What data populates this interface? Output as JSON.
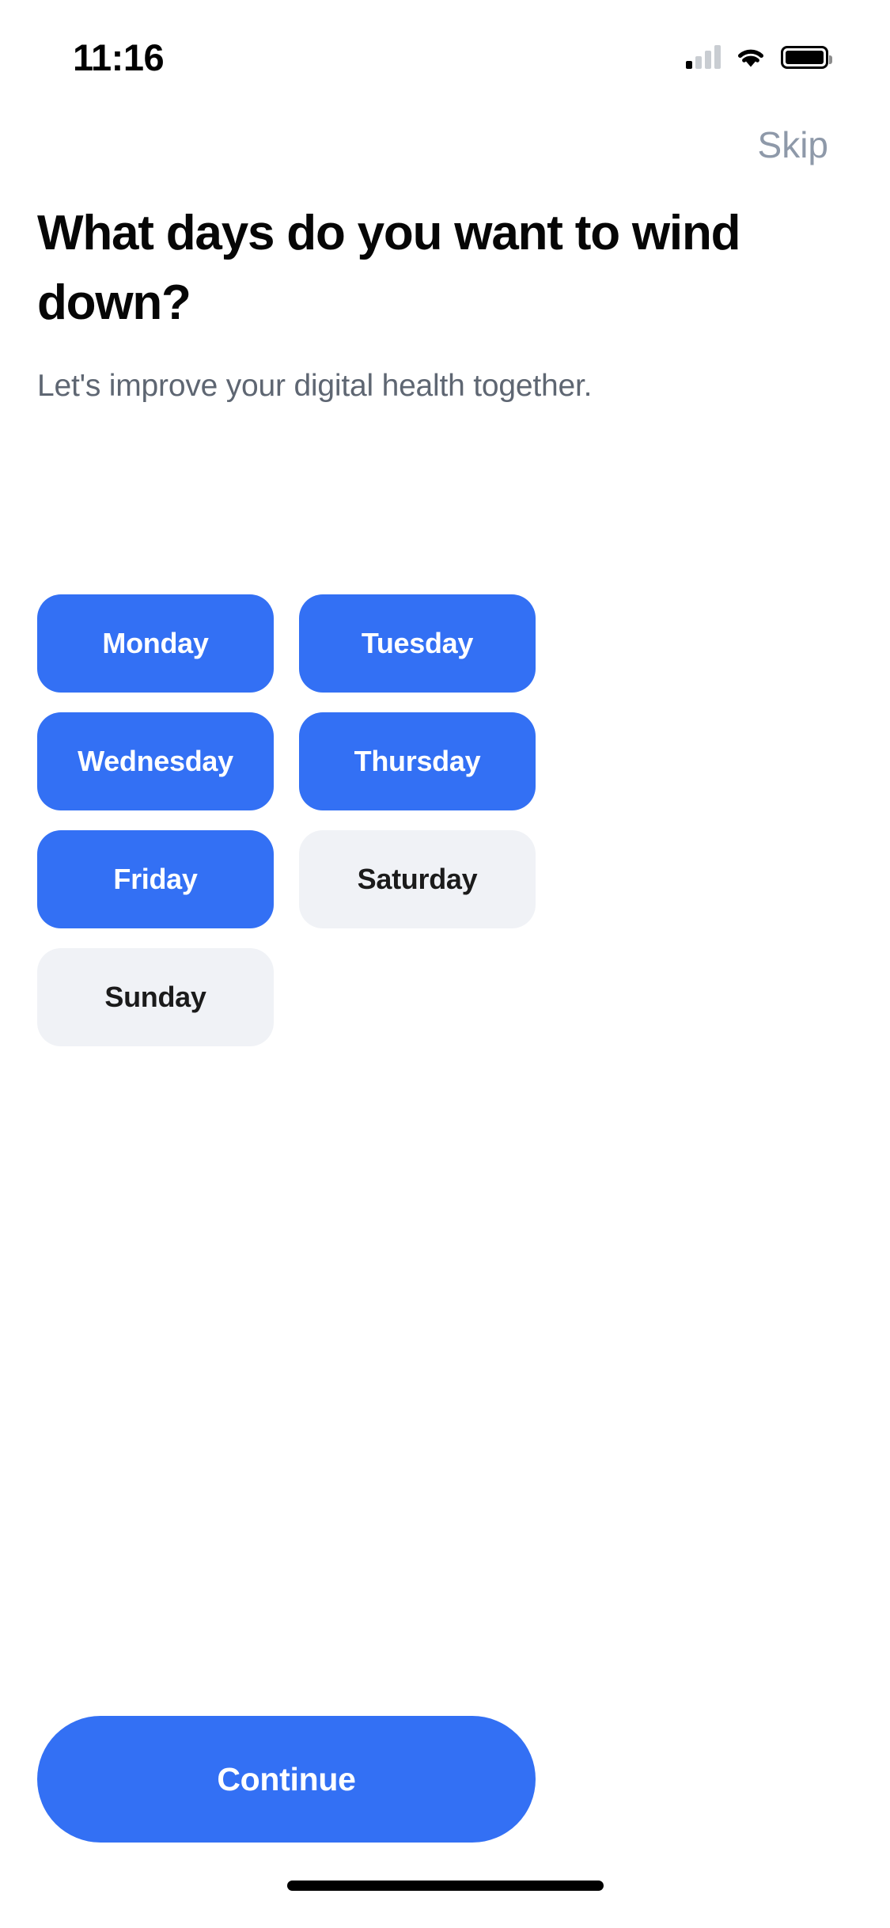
{
  "status_bar": {
    "time": "11:16",
    "cellular_icon": "cellular-signal-icon",
    "cellular_bars_active": 1,
    "cellular_bars_total": 4,
    "wifi_icon": "wifi-icon",
    "battery_icon": "battery-icon",
    "battery_level_percent": 100
  },
  "header": {
    "skip_label": "Skip",
    "title": "What days do you want to wind down?",
    "subtitle": "Let's improve your digital health together."
  },
  "days": [
    {
      "label": "Monday",
      "selected": true
    },
    {
      "label": "Tuesday",
      "selected": true
    },
    {
      "label": "Wednesday",
      "selected": true
    },
    {
      "label": "Thursday",
      "selected": true
    },
    {
      "label": "Friday",
      "selected": true
    },
    {
      "label": "Saturday",
      "selected": false
    },
    {
      "label": "Sunday",
      "selected": false
    }
  ],
  "footer": {
    "continue_label": "Continue",
    "home_indicator": "home-indicator"
  },
  "colors": {
    "accent_blue": "#3370f4",
    "unselected_gray": "#f0f2f6",
    "skip_gray": "#8e99a9",
    "subtitle_gray": "#5e6672",
    "title_black": "#060606",
    "background": "#ffffff"
  }
}
